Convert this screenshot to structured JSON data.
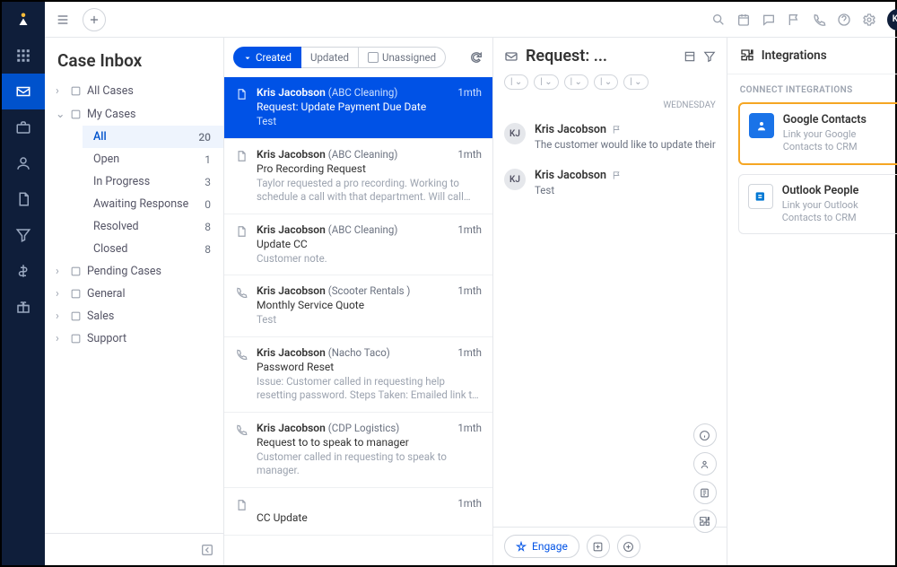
{
  "avatar_initials": "KJ",
  "sidebar": {
    "title": "Case Inbox",
    "all_cases": "All Cases",
    "my_cases": "My Cases",
    "filters": [
      {
        "label": "All",
        "count": 20,
        "active": true
      },
      {
        "label": "Open",
        "count": 1
      },
      {
        "label": "In Progress",
        "count": 3
      },
      {
        "label": "Awaiting Response",
        "count": 0
      },
      {
        "label": "Resolved",
        "count": 8
      },
      {
        "label": "Closed",
        "count": 8
      }
    ],
    "folders": [
      "Pending Cases",
      "General",
      "Sales",
      "Support"
    ]
  },
  "tabs": {
    "created": "Created",
    "updated": "Updated",
    "unassigned": "Unassigned"
  },
  "cases": [
    {
      "icon": "doc",
      "name": "Kris Jacobson",
      "company": "(ABC Cleaning)",
      "time": "1mth",
      "subject": "Request: Update Payment Due Date",
      "preview": "Test",
      "selected": true
    },
    {
      "icon": "doc",
      "name": "Kris Jacobson",
      "company": "(ABC Cleaning)",
      "time": "1mth",
      "subject": "Pro Recording Request",
      "preview": "Taylor requested a pro recording. Working to schedule a call with that department. Will call Taylor back once scheduled."
    },
    {
      "icon": "doc",
      "name": "Kris Jacobson",
      "company": "(ABC Cleaning)",
      "time": "1mth",
      "subject": "Update CC",
      "preview": "Customer note."
    },
    {
      "icon": "phone",
      "name": "Kris Jacobson",
      "company": "(Scooter Rentals )",
      "time": "1mth",
      "subject": "Monthly Service Quote",
      "preview": "Test"
    },
    {
      "icon": "phone",
      "name": "Kris Jacobson",
      "company": "(Nacho Taco)",
      "time": "1mth",
      "subject": "Password Reset",
      "preview": "Issue: Customer called in requesting help resetting password.  Steps Taken: Emailed link to reset password and"
    },
    {
      "icon": "phone",
      "name": "Kris Jacobson",
      "company": "(CDP Logistics)",
      "time": "1mth",
      "subject": "Request to to speak to manager",
      "preview": "Customer called in requesting to speak to manager."
    },
    {
      "icon": "doc",
      "name": "",
      "company": "",
      "time": "1mth",
      "subject": "CC Update",
      "preview": ""
    }
  ],
  "detail": {
    "title": "Request: ...",
    "day": "WEDNESDAY",
    "messages": [
      {
        "initials": "KJ",
        "name": "Kris Jacobson",
        "text": "The customer would like to update their"
      },
      {
        "initials": "KJ",
        "name": "Kris Jacobson",
        "text": "Test"
      }
    ],
    "engage": "Engage"
  },
  "panel": {
    "title": "Integrations",
    "section": "CONNECT INTEGRATIONS",
    "cards": [
      {
        "title": "Google Contacts",
        "desc": "Link your Google Contacts to CRM",
        "highlight": true,
        "kind": "google"
      },
      {
        "title": "Outlook People",
        "desc": "Link your Outlook Contacts to CRM",
        "highlight": false,
        "kind": "outlook"
      }
    ]
  }
}
